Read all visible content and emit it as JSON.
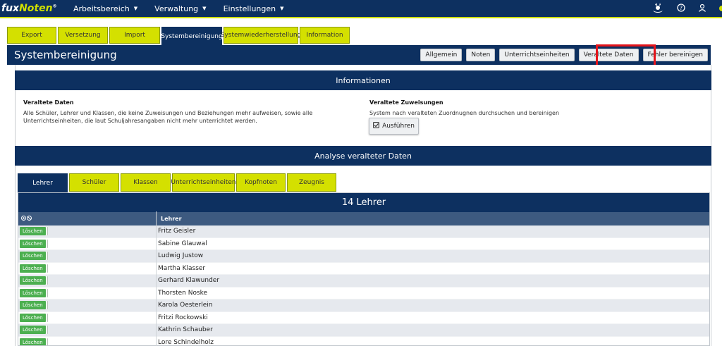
{
  "nav": {
    "logo_part1": "fux",
    "logo_part2": "Noten",
    "logo_reg": "®",
    "menu": [
      {
        "label": "Arbeitsbereich"
      },
      {
        "label": "Verwaltung"
      },
      {
        "label": "Einstellungen"
      }
    ]
  },
  "main_tabs": [
    "Export",
    "Versetzung",
    "Import",
    "Systembereinigung",
    "Systemwiederherstellung",
    "Information"
  ],
  "page": {
    "title": "Systembereinigung",
    "buttons": [
      "Allgemein",
      "Noten",
      "Unterrichtseinheiten",
      "Veraltete Daten",
      "Fehler bereinigen"
    ]
  },
  "info": {
    "header": "Informationen",
    "col1_title": "Veraltete Daten",
    "col1_text": "Alle Schüler, Lehrer und Klassen, die keine Zuweisungen und Beziehungen mehr aufweisen, sowie alle Unterrichtseinheiten, die laut Schuljahresangaben nicht mehr unterrichtet werden.",
    "col2_title": "Veraltete Zuweisungen",
    "col2_text": "System nach veralteten Zuordnugnen durchsuchen und bereinigen",
    "run_button": "Ausführen"
  },
  "analysis": {
    "header": "Analyse veralteter Daten",
    "tabs": [
      "Lehrer",
      "Schüler",
      "Klassen",
      "Unterrichtseinheiten",
      "Kopfnoten",
      "Zeugnis"
    ],
    "table_title": "14 Lehrer",
    "col_header": "Lehrer",
    "delete_label": "Löschen",
    "rows": [
      "Fritz Geisler",
      "Sabine Glauwal",
      "Ludwig Justow",
      "Martha Klasser",
      "Gerhard Klawunder",
      "Thorsten Noske",
      "Karola Oesterlein",
      "Fritzi Rockowski",
      "Kathrin Schauber",
      "Lore Schindelholz"
    ]
  },
  "colors": {
    "navy": "#0d3060",
    "lime": "#d4e000",
    "green": "#4caf50",
    "highlight": "#e5141b"
  }
}
